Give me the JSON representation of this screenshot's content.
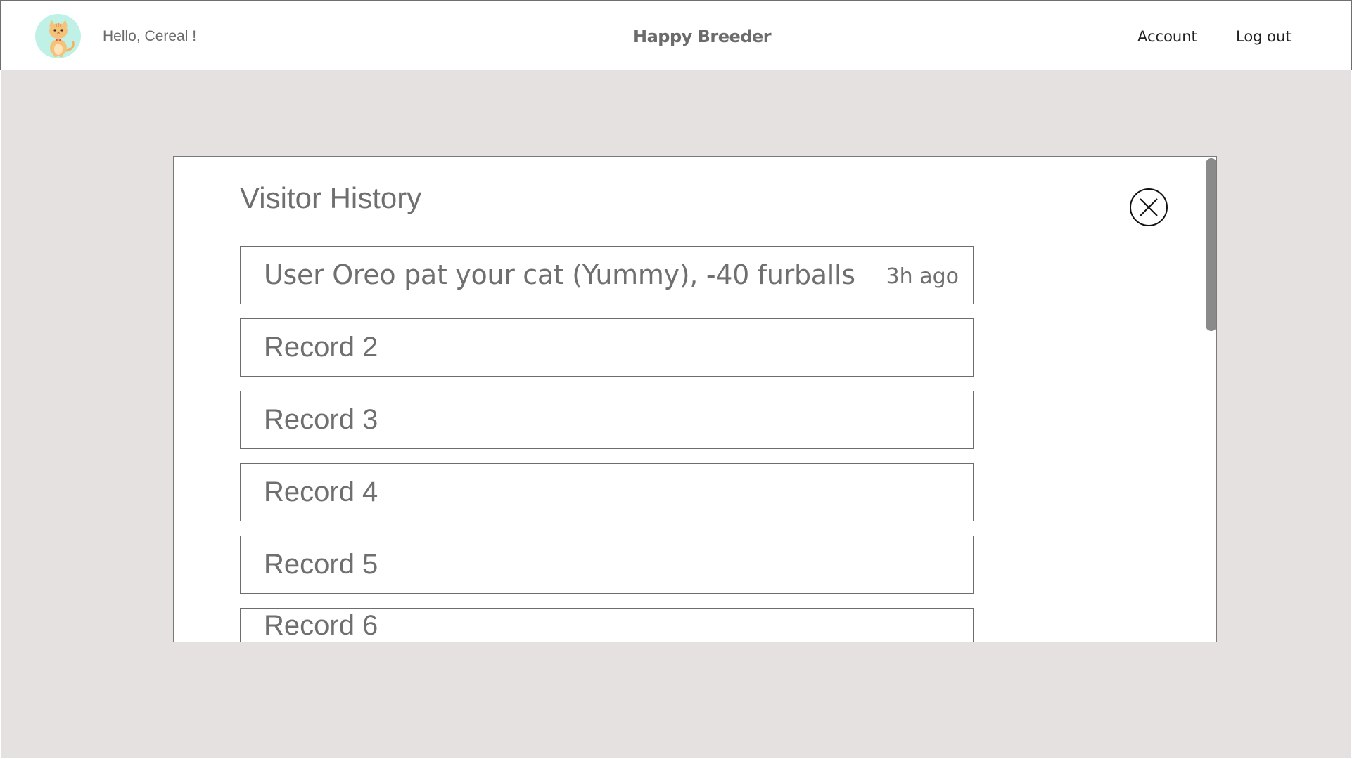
{
  "header": {
    "greeting": "Hello, Cereal !",
    "brand": "Happy Breeder",
    "nav": {
      "account": "Account",
      "logout": "Log out"
    },
    "avatar_icon": "cat-avatar-icon",
    "avatar_bg": "#bff1e6"
  },
  "modal": {
    "title": "Visitor History",
    "close_icon": "close-circle-icon",
    "records": [
      {
        "text": "User Oreo pat your cat (Yummy), -40 furballs",
        "time": "3h ago"
      },
      {
        "text": "Record 2",
        "time": ""
      },
      {
        "text": "Record 3",
        "time": ""
      },
      {
        "text": "Record 4",
        "time": ""
      },
      {
        "text": "Record 5",
        "time": ""
      },
      {
        "text": "Record 6",
        "time": ""
      }
    ]
  },
  "colors": {
    "backdrop": "#e6e1e1",
    "text_gray": "#6f6f6f",
    "border": "#6d6d6d",
    "scroll_thumb": "#8a8a8a"
  }
}
